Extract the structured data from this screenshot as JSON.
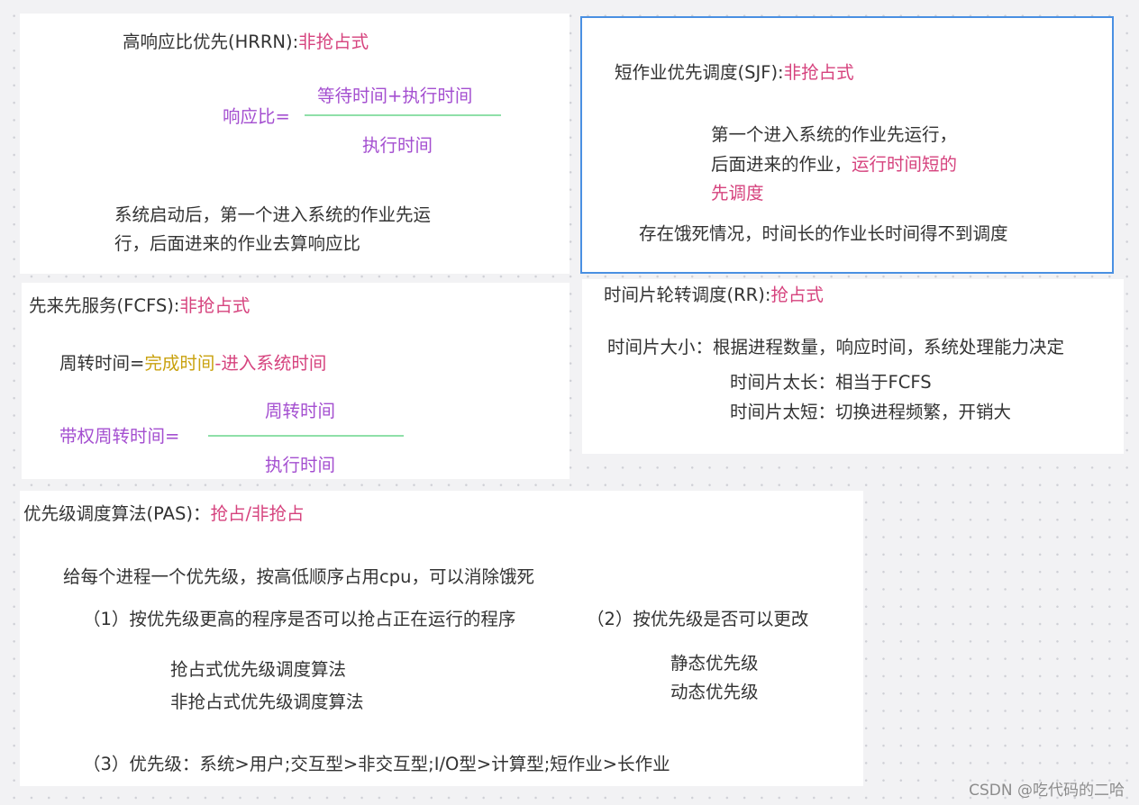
{
  "hrrn": {
    "title": "高响应比优先(HRRN):",
    "title_mode": "非抢占式",
    "ratio_label": "响应比=",
    "numerator": "等待时间+执行时间",
    "denominator": "执行时间",
    "desc_line1": "系统启动后，第一个进入系统的作业先运",
    "desc_line2": "行，后面进来的作业去算响应比"
  },
  "sjf": {
    "title": "短作业优先调度(SJF):",
    "title_mode": "非抢占式",
    "line1": "第一个进入系统的作业先运行，",
    "line2_a": "后面进来的作业，",
    "line2_b": "运行时间短的",
    "line3": "先调度",
    "note": "存在饿死情况，时间长的作业长时间得不到调度"
  },
  "fcfs": {
    "title": "先来先服务(FCFS):",
    "title_mode": "非抢占式",
    "turnaround_label": "周转时间=",
    "turnaround_a": "完成时间",
    "turnaround_b": "-进入系统时间",
    "weighted_label": "带权周转时间=",
    "numerator": "周转时间",
    "denominator": "执行时间"
  },
  "rr": {
    "title": "时间片轮转调度(RR):",
    "title_mode": "抢占式",
    "size_line": "时间片大小：根据进程数量，响应时间，系统处理能力决定",
    "too_long": "时间片太长：相当于FCFS",
    "too_short": "时间片太短：切换进程频繁，开销大"
  },
  "pas": {
    "title": "优先级调度算法(PAS)：",
    "title_mode": "抢占/非抢占",
    "intro": "给每个进程一个优先级，按高低顺序占用cpu，可以消除饿死",
    "item1": "（1）按优先级更高的程序是否可以抢占正在运行的程序",
    "item2": "（2）按优先级是否可以更改",
    "item1_a": "抢占式优先级调度算法",
    "item1_b": "非抢占式优先级调度算法",
    "item2_a": "静态优先级",
    "item2_b": "动态优先级",
    "item3": "（3）优先级：系统>用户;交互型>非交互型;I/O型>计算型;短作业>长作业"
  },
  "watermark": "CSDN @吃代码的二哈",
  "colors": {
    "accent_pink": "#d6437e",
    "accent_purple": "#a44fd0",
    "accent_gold": "#c9a20f",
    "fraction_line": "#8fe0a8",
    "selected_border": "#4a90e2"
  }
}
